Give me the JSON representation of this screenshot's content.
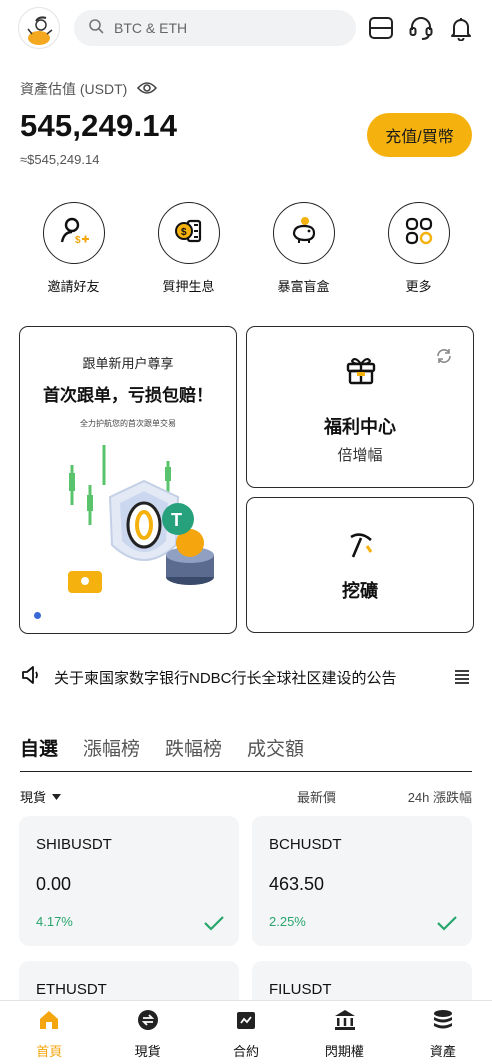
{
  "header": {
    "search_placeholder": "BTC & ETH",
    "icons": [
      "avatar",
      "search-icon",
      "scan-icon",
      "headset-icon",
      "bell-icon"
    ]
  },
  "assets": {
    "label": "資產估值 (USDT)",
    "value": "545,249.14",
    "approx": "≈$545,249.14",
    "deposit_label": "充值/買幣"
  },
  "quick_actions": [
    {
      "label": "邀請好友",
      "icon": "invite-user-icon"
    },
    {
      "label": "質押生息",
      "icon": "staking-coin-icon"
    },
    {
      "label": "暴富盲盒",
      "icon": "piggy-bank-icon"
    },
    {
      "label": "更多",
      "icon": "grid-more-icon"
    }
  ],
  "banner": {
    "subtitle": "跟单新用户尊享",
    "title": "首次跟单，亏损包赔！",
    "note": "全力护航您的首次跟单交易"
  },
  "welfare": {
    "title": "福利中心",
    "subtitle": "倍增幅"
  },
  "mining": {
    "title": "挖礦"
  },
  "announcement": {
    "text": "关于柬国家数字银行NDBC行长全球社区建设的公告"
  },
  "tabs": [
    {
      "label": "自選",
      "active": true
    },
    {
      "label": "漲幅榜",
      "active": false
    },
    {
      "label": "跌幅榜",
      "active": false
    },
    {
      "label": "成交額",
      "active": false
    }
  ],
  "list_header": {
    "market": "現貨",
    "price": "最新價",
    "change": "24h 漲跌幅"
  },
  "markets": [
    {
      "symbol": "SHIBUSDT",
      "price": "0.00",
      "change": "4.17%"
    },
    {
      "symbol": "BCHUSDT",
      "price": "463.50",
      "change": "2.25%"
    },
    {
      "symbol": "ETHUSDT",
      "price": "",
      "change": ""
    },
    {
      "symbol": "FILUSDT",
      "price": "",
      "change": ""
    }
  ],
  "nav": [
    {
      "label": "首頁",
      "active": true
    },
    {
      "label": "現貨",
      "active": false
    },
    {
      "label": "合約",
      "active": false
    },
    {
      "label": "閃期權",
      "active": false
    },
    {
      "label": "資產",
      "active": false
    }
  ],
  "colors": {
    "accent": "#f5b10d",
    "positive": "#27a66c",
    "nav_active": "#f5a50d"
  }
}
